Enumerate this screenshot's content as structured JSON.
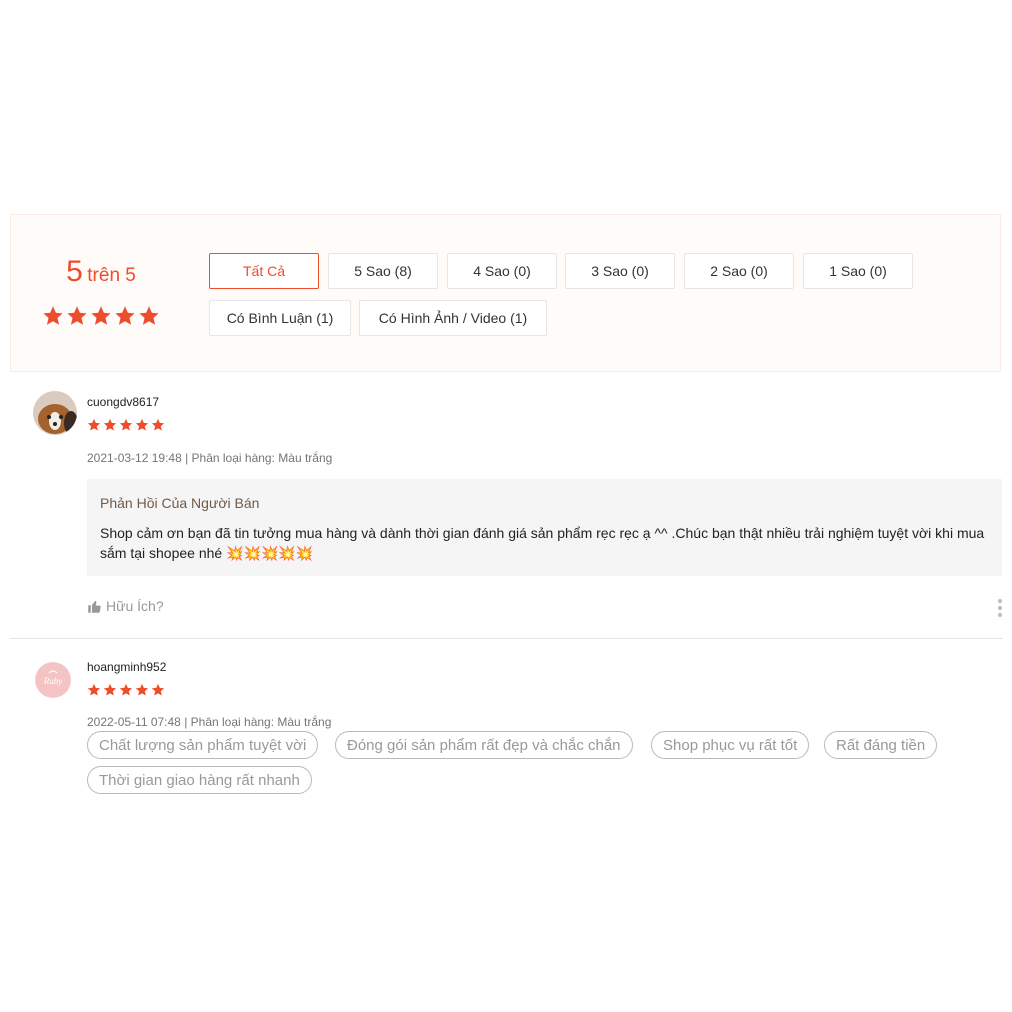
{
  "summary": {
    "score": "5",
    "score_suffix": "trên 5",
    "rating": 5,
    "filters": [
      {
        "label": "Tất Cả",
        "active": true
      },
      {
        "label": "5 Sao (8)"
      },
      {
        "label": "4 Sao (0)"
      },
      {
        "label": "3 Sao (0)"
      },
      {
        "label": "2 Sao (0)"
      },
      {
        "label": "1 Sao (0)"
      },
      {
        "label": "Có Bình Luận (1)"
      },
      {
        "label": "Có Hình Ảnh / Video (1)"
      }
    ]
  },
  "reviews": [
    {
      "username": "cuongdv8617",
      "rating": 5,
      "meta": "2021-03-12 19:48 | Phân loại hàng: Màu trắng",
      "seller_reply": {
        "title": "Phản Hồi Của Người Bán",
        "text": "Shop cảm ơn bạn đã tin tưởng mua hàng và dành thời gian đánh giá sản phẩm rẹc rẹc ạ ^^ .Chúc bạn thật nhiều trải nghiệm tuyệt vời khi mua sắm tại shopee nhé 💥💥💥💥💥"
      },
      "helpful_label": "Hữu Ích?"
    },
    {
      "username": "hoangminh952",
      "rating": 5,
      "meta": "2022-05-11 07:48 | Phân loại hàng: Màu trắng",
      "tags": [
        "Chất lượng sản phẩm tuyệt vời",
        "Đóng gói sản phẩm rất đẹp và chắc chắn",
        "Shop phục vụ rất tốt",
        "Rất đáng tiền",
        "Thời gian giao hàng rất nhanh"
      ]
    }
  ],
  "colors": {
    "accent": "#ee4d2d",
    "summary_bg": "#fffbf8",
    "reply_bg": "#f5f5f5"
  },
  "icons": [
    "star-icon",
    "thumbs-up-icon",
    "more-vertical-icon"
  ]
}
